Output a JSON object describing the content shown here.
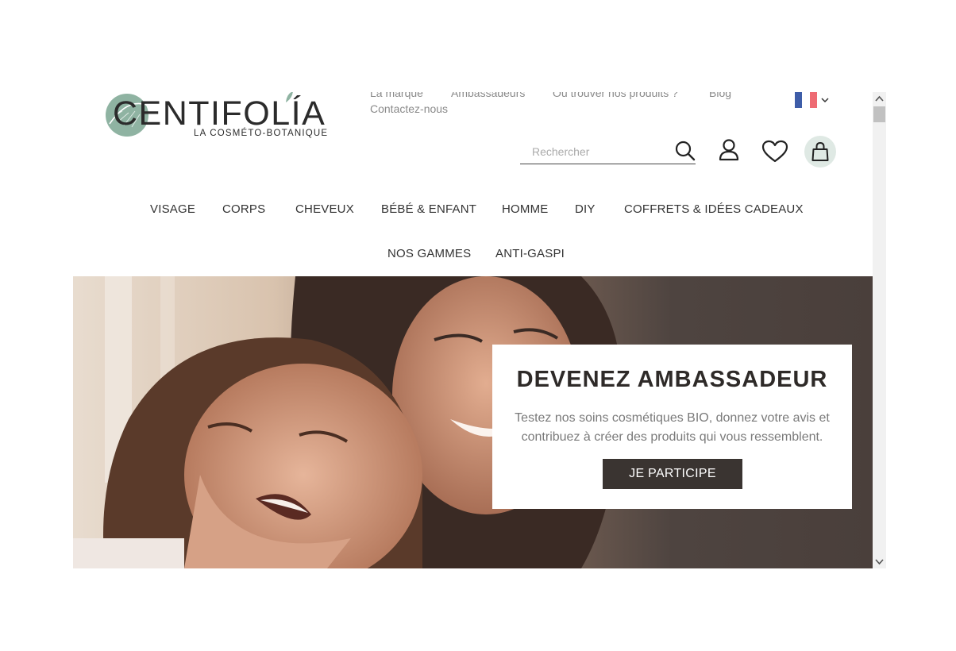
{
  "brand": {
    "name": "CENTIFOLÍA",
    "tagline": "LA COSMÉTO-BOTANIQUE"
  },
  "top_links": [
    "La marque",
    "Ambassadeurs",
    "Où trouver nos produits ?",
    "Blog",
    "Contactez-nous"
  ],
  "language": {
    "flag": "france-flag-icon",
    "chevron": "chevron-down-icon"
  },
  "search": {
    "placeholder": "Rechercher",
    "icon": "search-icon"
  },
  "header_icons": [
    "account-icon",
    "wishlist-heart-icon",
    "shopping-bag-icon"
  ],
  "nav": {
    "row1": [
      "VISAGE",
      "CORPS",
      "CHEVEUX",
      "BÉBÉ & ENFANT",
      "HOMME",
      "DIY",
      "COFFRETS & IDÉES CADEAUX"
    ],
    "row2": [
      "NOS GAMMES",
      "ANTI-GASPI"
    ]
  },
  "hero": {
    "title": "DEVENEZ AMBASSADEUR",
    "text": "Testez nos soins cosmétiques BIO, donnez votre avis et contribuez à créer des produits qui vous ressemblent.",
    "cta": "JE PARTICIPE"
  },
  "colors": {
    "accent_circle": "#dfe9e4",
    "logo_green": "#8fb3a2",
    "button_dark": "#3a3431",
    "flag_blue": "#3e5da8",
    "flag_red": "#ee6b73"
  }
}
